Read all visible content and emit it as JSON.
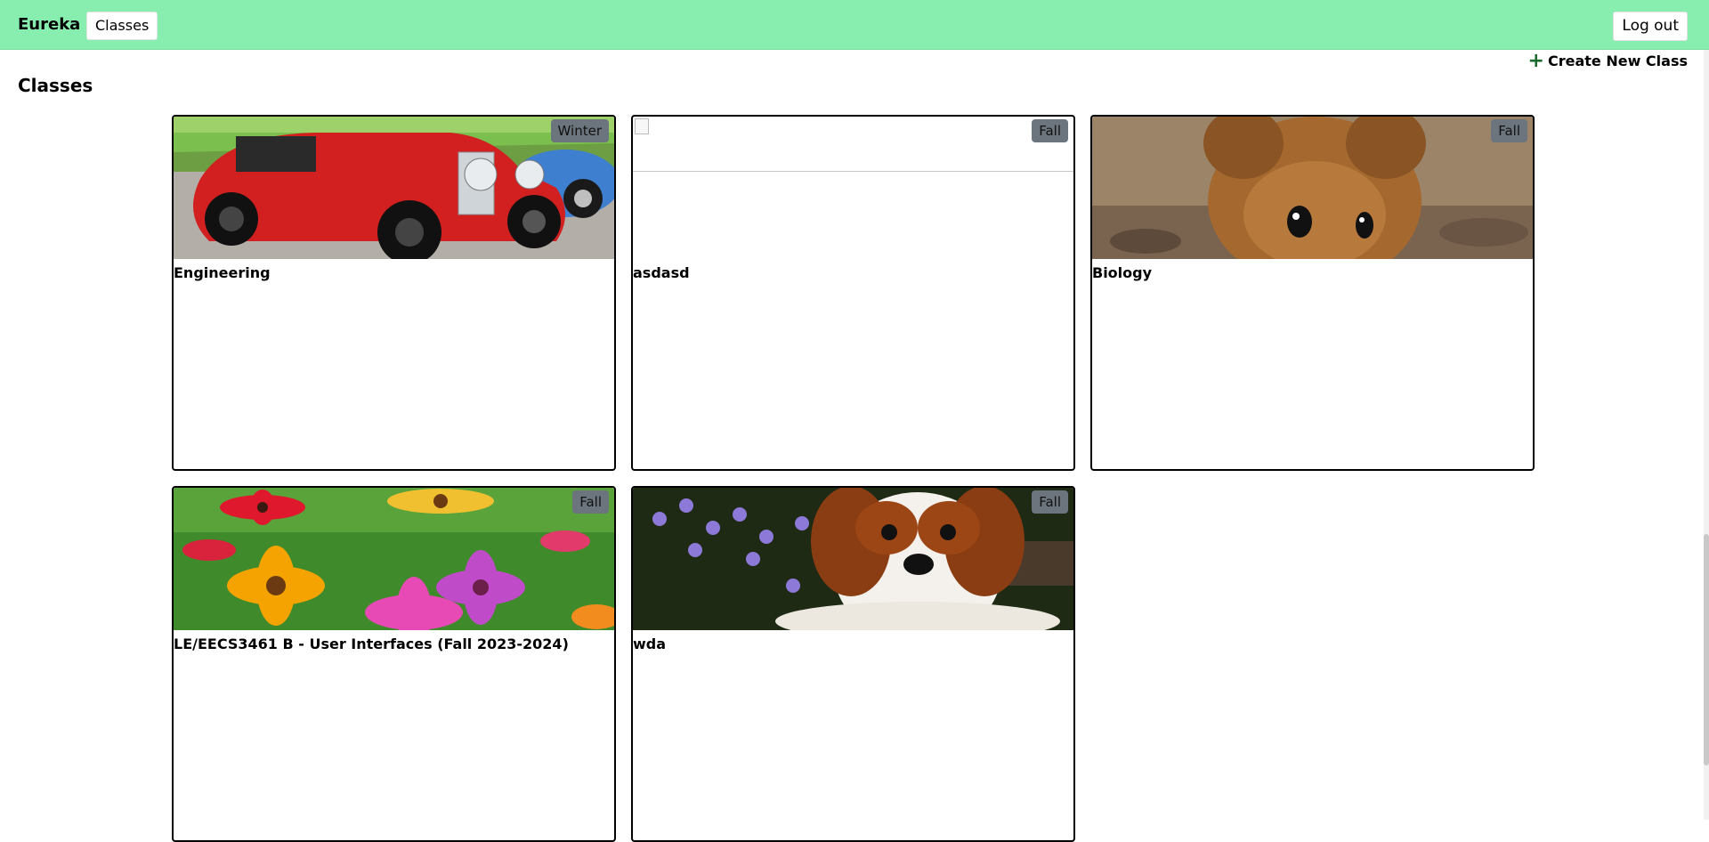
{
  "topbar": {
    "brand": "Eureka",
    "nav_label": "Classes",
    "logout_label": "Log out",
    "background": "#88eeb0"
  },
  "main": {
    "title": "Classes",
    "create_label": "Create New Class"
  },
  "classes": [
    {
      "name": "Engineering",
      "term": "Winter",
      "image": "red-vintage-car"
    },
    {
      "name": "asdasd",
      "term": "Fall",
      "image": "broken-image"
    },
    {
      "name": "Biology",
      "term": "Fall",
      "image": "mouse"
    },
    {
      "name": "LE/EECS3461 B - User Interfaces (Fall 2023-2024)",
      "term": "Fall",
      "image": "flowers"
    },
    {
      "name": "wda",
      "term": "Fall",
      "image": "puppy"
    }
  ]
}
